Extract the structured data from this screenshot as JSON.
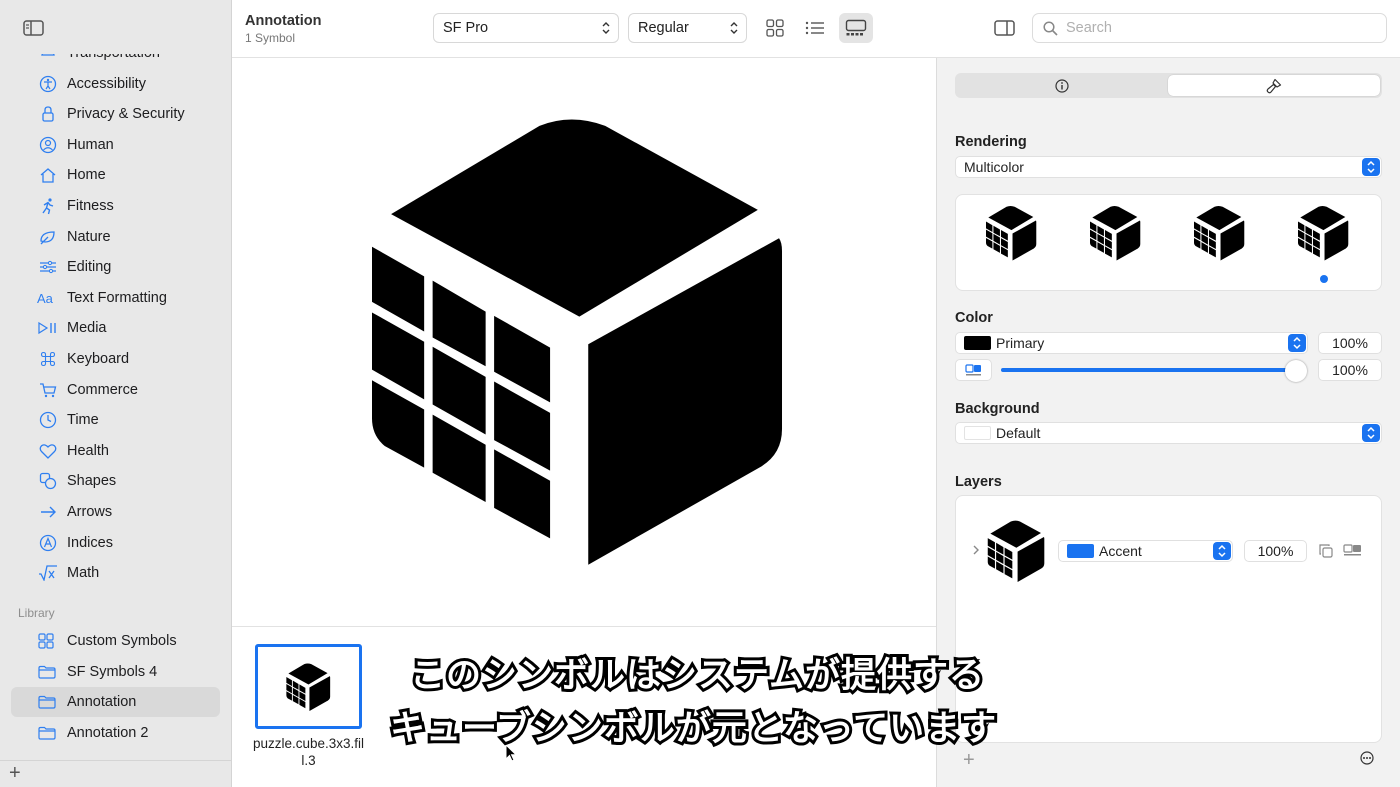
{
  "sidebar": {
    "categories": [
      {
        "label": "Transportation",
        "icon": "car-icon"
      },
      {
        "label": "Accessibility",
        "icon": "accessibility-icon"
      },
      {
        "label": "Privacy & Security",
        "icon": "lock-icon"
      },
      {
        "label": "Human",
        "icon": "person-icon"
      },
      {
        "label": "Home",
        "icon": "house-icon"
      },
      {
        "label": "Fitness",
        "icon": "running-figure-icon"
      },
      {
        "label": "Nature",
        "icon": "leaf-icon"
      },
      {
        "label": "Editing",
        "icon": "sliders-icon"
      },
      {
        "label": "Text Formatting",
        "icon": "text-format-icon"
      },
      {
        "label": "Media",
        "icon": "play-pause-icon"
      },
      {
        "label": "Keyboard",
        "icon": "command-icon"
      },
      {
        "label": "Commerce",
        "icon": "cart-icon"
      },
      {
        "label": "Time",
        "icon": "clock-icon"
      },
      {
        "label": "Health",
        "icon": "heart-icon"
      },
      {
        "label": "Shapes",
        "icon": "shapes-icon"
      },
      {
        "label": "Arrows",
        "icon": "arrow-right-icon"
      },
      {
        "label": "Indices",
        "icon": "circled-a-icon"
      },
      {
        "label": "Math",
        "icon": "square-root-icon"
      }
    ],
    "library_heading": "Library",
    "library": [
      {
        "label": "Custom Symbols",
        "icon": "grid-icon",
        "selected": false
      },
      {
        "label": "SF Symbols 4",
        "icon": "folder-icon",
        "selected": false
      },
      {
        "label": "Annotation",
        "icon": "folder-icon",
        "selected": true
      },
      {
        "label": "Annotation 2",
        "icon": "folder-icon",
        "selected": false
      }
    ],
    "add_label": "+"
  },
  "toolbar": {
    "title": "Annotation",
    "subtitle": "1 Symbol",
    "font": "SF Pro",
    "weight": "Regular",
    "search_placeholder": "Search",
    "active_view": "gallery"
  },
  "gallery": {
    "symbol_name": "puzzle.cube.3x3.fill.3"
  },
  "inspector": {
    "active_tab": "customize",
    "rendering_label": "Rendering",
    "rendering_value": "Multicolor",
    "selected_variant": 4,
    "color_label": "Color",
    "color_value": "Primary",
    "color_swatch": "#000000",
    "color_opacity": "100%",
    "slider_opacity": "100%",
    "slider_level": 1.0,
    "background_label": "Background",
    "background_value": "Default",
    "layers_label": "Layers",
    "layer": {
      "color_name": "Accent",
      "color": "#1a73f0",
      "opacity": "100%"
    },
    "add_label": "+"
  },
  "subtitles": {
    "line1": "このシンボルはシステムが提供する",
    "line2": "キューブシンボルが元となっています"
  },
  "colors": {
    "accent": "#1a73f0",
    "sidebar": "#e8e8e8",
    "inspector": "#f2f2f2"
  }
}
